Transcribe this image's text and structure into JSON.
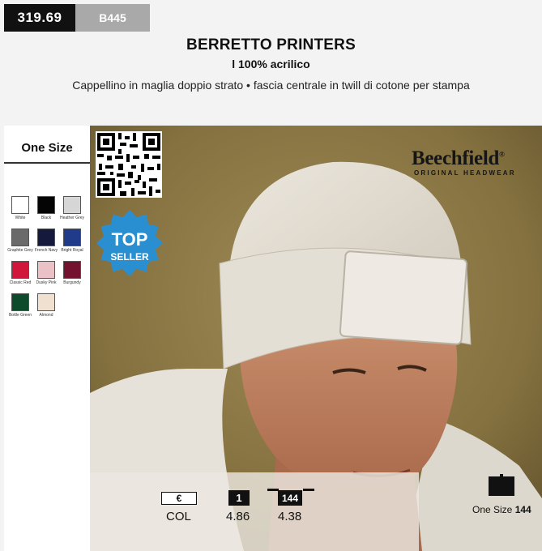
{
  "header": {
    "code": "319.69",
    "sku": "B445",
    "title": "BERRETTO PRINTERS",
    "subtitle": "l 100% acrilico",
    "description": "Cappellino in maglia doppio strato • fascia centrale in twill di cotone per stampa"
  },
  "sizes": {
    "heading": "One Size"
  },
  "colors": [
    {
      "name": "White",
      "hex": "#ffffff"
    },
    {
      "name": "Black",
      "hex": "#050505"
    },
    {
      "name": "Heather Grey",
      "hex": "#d6d6d6"
    },
    {
      "name": "Graphite Grey",
      "hex": "#6a6a6a"
    },
    {
      "name": "French Navy",
      "hex": "#15193b"
    },
    {
      "name": "Bright Royal",
      "hex": "#1f3b8a"
    },
    {
      "name": "Classic Red",
      "hex": "#d1163b"
    },
    {
      "name": "Dusky Pink",
      "hex": "#e9c1c6"
    },
    {
      "name": "Burgundy",
      "hex": "#74112e"
    },
    {
      "name": "Bottle Green",
      "hex": "#0d4a2c"
    },
    {
      "name": "Almond",
      "hex": "#efe0cf"
    }
  ],
  "badge": {
    "line1": "TOP",
    "line2": "SELLER",
    "color": "#2a8fd1"
  },
  "brand": {
    "name": "Beechfield",
    "mark": "®",
    "tagline": "ORIGINAL HEADWEAR"
  },
  "pricing": {
    "currency_label": "€",
    "qty_label_1": "1",
    "qty_label_2": "144",
    "row_label": "COL",
    "price_1": "4.86",
    "price_144": "4.38"
  },
  "packaging": {
    "size_label": "One Size",
    "quantity": "144",
    "icon": "box-icon"
  }
}
